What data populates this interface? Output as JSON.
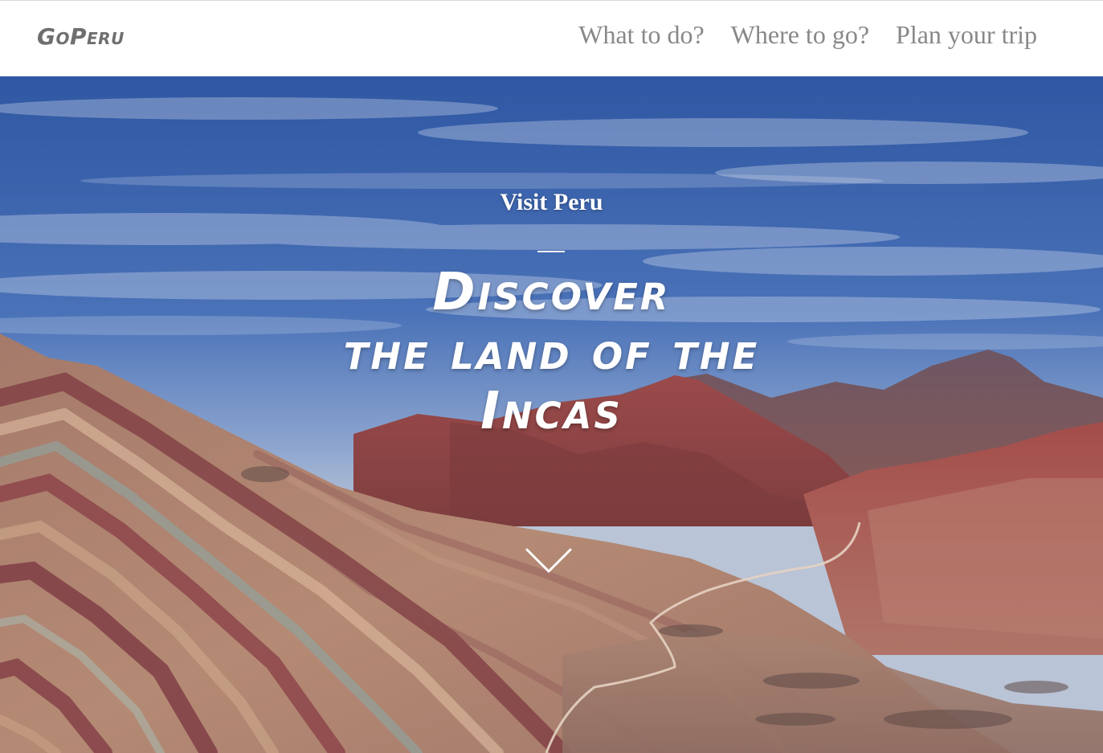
{
  "brand": {
    "logo": "GoPeru"
  },
  "nav": {
    "items": [
      {
        "label": "What to do?"
      },
      {
        "label": "Where to go?"
      },
      {
        "label": "Plan your trip"
      }
    ]
  },
  "hero": {
    "eyebrow": "Visit Peru",
    "title_lines": [
      "Discover",
      "the land of the",
      "Incas"
    ],
    "scroll_icon": "chevron-down-icon",
    "background": "rainbow-mountain-photo"
  },
  "colors": {
    "nav_text": "#888888",
    "logo_text": "#6f6f6f",
    "hero_text": "#ffffff",
    "sky": "#3a62a8"
  }
}
